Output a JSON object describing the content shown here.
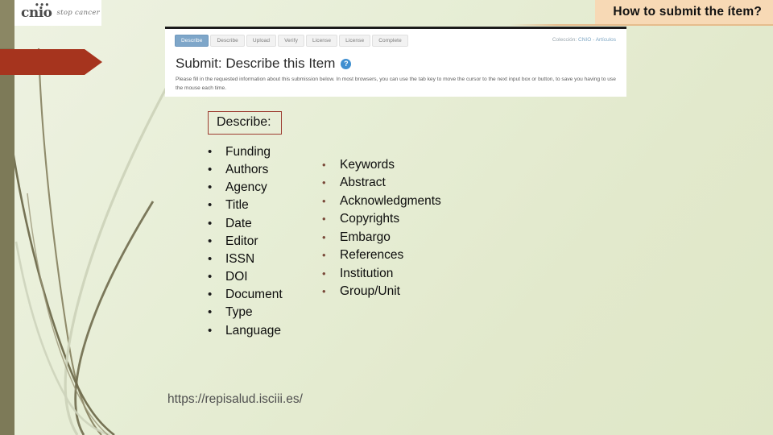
{
  "slide": {
    "banner_title": "How to submit the ítem?",
    "url_text": "https://repisalud.isciii.es/"
  },
  "logo": {
    "mark": "cnio",
    "dots": "•••",
    "tagline": "stop cancer"
  },
  "screenshot": {
    "tabs": [
      {
        "label": "Describe",
        "active": true
      },
      {
        "label": "Describe",
        "active": false
      },
      {
        "label": "Upload",
        "active": false
      },
      {
        "label": "Verify",
        "active": false
      },
      {
        "label": "License",
        "active": false
      },
      {
        "label": "License",
        "active": false
      },
      {
        "label": "Complete",
        "active": false
      }
    ],
    "collection_label": "Colección:",
    "collection_value": "CNIO - Artículos",
    "page_title": "Submit: Describe this Item",
    "help_icon_glyph": "?",
    "instructions": "Please fill in the requested information about this submission below. In most browsers, you can use the tab key to move the cursor to the next input box or button, to save you having to use the mouse each time."
  },
  "describe": {
    "heading": "Describe:",
    "bullet_glyph": "•",
    "column_left": [
      "Funding",
      "Authors",
      "Agency",
      "Title",
      "Date",
      "Editor",
      "ISSN",
      "DOI",
      "Document",
      "Type",
      "Language"
    ],
    "column_right": [
      "Keywords",
      "Abstract",
      "Acknowledgments",
      "Copyrights",
      "Embargo",
      "References",
      "Institution",
      "Group/Unit"
    ]
  },
  "colors": {
    "background_green": "#e7eed6",
    "banner_peach": "#f7d9b5",
    "arrow_red": "#a6341e",
    "left_bar_olive": "#7d7a58",
    "describe_border": "#9d3c30",
    "tab_active_blue": "#7ea6c9",
    "help_badge_blue": "#3f8fd0"
  }
}
